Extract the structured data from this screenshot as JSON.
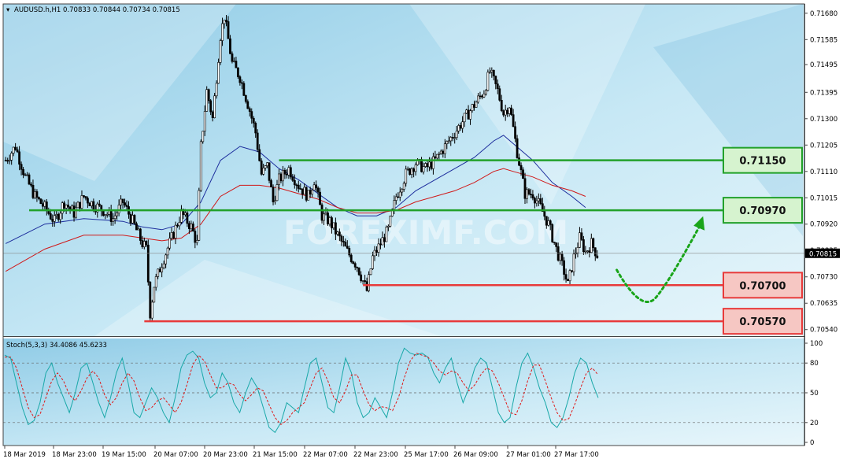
{
  "header": {
    "symbol_line": "AUDUSD.h,H1  0.70833 0.70844 0.70734 0.70815"
  },
  "stoch_header": "Stoch(5,3,3) 34.4086 45.6233",
  "watermark": "FOREXIMF.COM",
  "colors": {
    "bg_top": "#9fd3ea",
    "bg_bottom": "#d9f0f9",
    "bull": "#ffffff",
    "bear": "#000000",
    "ma_blue": "#1c2c9c",
    "ma_red": "#d01818",
    "support": "#e83a3a",
    "resistance": "#22a12a",
    "stoch_main": "#19a8a8",
    "stoch_signal": "#e01818",
    "arrow": "#1aa51a"
  },
  "chart_data": [
    {
      "type": "candlestick",
      "title": "AUDUSD.h,H1",
      "ohlc_readout": {
        "open": 0.70833,
        "high": 0.70844,
        "low": 0.70734,
        "close": 0.70815
      },
      "last_price_label": "0.70815",
      "ylim": [
        0.70525,
        0.71705
      ],
      "y_ticks": [
        "0.71680",
        "0.71585",
        "0.71495",
        "0.71395",
        "0.71300",
        "0.71205",
        "0.71110",
        "0.71015",
        "0.70920",
        "0.70825",
        "0.70730",
        "0.70635",
        "0.70540"
      ],
      "x_ticks": [
        "18 Mar 2019",
        "18 Mar 23:00",
        "19 Mar 15:00",
        "20 Mar 07:00",
        "20 Mar 23:00",
        "21 Mar 15:00",
        "22 Mar 07:00",
        "22 Mar 23:00",
        "25 Mar 17:00",
        "26 Mar 09:00",
        "27 Mar 01:00",
        "27 Mar 17:00"
      ],
      "path_points": [
        [
          0,
          0.7115
        ],
        [
          5,
          0.712
        ],
        [
          10,
          0.7109
        ],
        [
          15,
          0.7102
        ],
        [
          20,
          0.7098
        ],
        [
          25,
          0.7093
        ],
        [
          30,
          0.71
        ],
        [
          35,
          0.7096
        ],
        [
          40,
          0.7102
        ],
        [
          45,
          0.7099
        ],
        [
          50,
          0.7097
        ],
        [
          55,
          0.7094
        ],
        [
          60,
          0.71
        ],
        [
          65,
          0.7093
        ],
        [
          70,
          0.7085
        ],
        [
          72,
          0.7083
        ],
        [
          74,
          0.706
        ],
        [
          76,
          0.707
        ],
        [
          80,
          0.7078
        ],
        [
          85,
          0.7087
        ],
        [
          90,
          0.7096
        ],
        [
          95,
          0.7091
        ],
        [
          98,
          0.7085
        ],
        [
          100,
          0.712
        ],
        [
          103,
          0.714
        ],
        [
          106,
          0.713
        ],
        [
          110,
          0.716
        ],
        [
          112,
          0.7167
        ],
        [
          116,
          0.715
        ],
        [
          120,
          0.7145
        ],
        [
          125,
          0.7133
        ],
        [
          128,
          0.7125
        ],
        [
          131,
          0.711
        ],
        [
          134,
          0.7113
        ],
        [
          137,
          0.71
        ],
        [
          140,
          0.7108
        ],
        [
          145,
          0.7112
        ],
        [
          150,
          0.7106
        ],
        [
          155,
          0.7102
        ],
        [
          158,
          0.7108
        ],
        [
          162,
          0.7095
        ],
        [
          166,
          0.7093
        ],
        [
          170,
          0.7088
        ],
        [
          175,
          0.7082
        ],
        [
          180,
          0.7077
        ],
        [
          185,
          0.7068
        ],
        [
          188,
          0.708
        ],
        [
          192,
          0.7085
        ],
        [
          196,
          0.709
        ],
        [
          200,
          0.7102
        ],
        [
          205,
          0.711
        ],
        [
          210,
          0.7114
        ],
        [
          215,
          0.7112
        ],
        [
          220,
          0.7115
        ],
        [
          225,
          0.712
        ],
        [
          230,
          0.7125
        ],
        [
          235,
          0.713
        ],
        [
          240,
          0.7135
        ],
        [
          245,
          0.714
        ],
        [
          248,
          0.7147
        ],
        [
          252,
          0.714
        ],
        [
          255,
          0.7132
        ],
        [
          258,
          0.7135
        ],
        [
          262,
          0.7118
        ],
        [
          266,
          0.7103
        ],
        [
          270,
          0.7103
        ],
        [
          274,
          0.7098
        ],
        [
          278,
          0.7092
        ],
        [
          282,
          0.7083
        ],
        [
          286,
          0.7075
        ],
        [
          288,
          0.707
        ],
        [
          291,
          0.708
        ],
        [
          294,
          0.7087
        ],
        [
          297,
          0.7082
        ],
        [
          300,
          0.7085
        ],
        [
          303,
          0.7081
        ]
      ],
      "moving_averages": [
        {
          "color": "blue",
          "points": [
            [
              0,
              0.7085
            ],
            [
              20,
              0.7092
            ],
            [
              40,
              0.7094
            ],
            [
              60,
              0.7093
            ],
            [
              70,
              0.7091
            ],
            [
              80,
              0.709
            ],
            [
              90,
              0.7092
            ],
            [
              100,
              0.71
            ],
            [
              110,
              0.7115
            ],
            [
              120,
              0.712
            ],
            [
              130,
              0.7118
            ],
            [
              140,
              0.7112
            ],
            [
              150,
              0.7108
            ],
            [
              160,
              0.7103
            ],
            [
              170,
              0.7098
            ],
            [
              180,
              0.7095
            ],
            [
              190,
              0.7095
            ],
            [
              200,
              0.7098
            ],
            [
              210,
              0.7104
            ],
            [
              220,
              0.7108
            ],
            [
              230,
              0.7112
            ],
            [
              240,
              0.7116
            ],
            [
              250,
              0.7122
            ],
            [
              255,
              0.7124
            ],
            [
              260,
              0.7121
            ],
            [
              270,
              0.7115
            ],
            [
              280,
              0.7107
            ],
            [
              290,
              0.7102
            ],
            [
              297,
              0.7098
            ]
          ]
        },
        {
          "color": "red",
          "points": [
            [
              0,
              0.7075
            ],
            [
              20,
              0.7083
            ],
            [
              40,
              0.7088
            ],
            [
              60,
              0.7088
            ],
            [
              70,
              0.7087
            ],
            [
              80,
              0.7086
            ],
            [
              90,
              0.7087
            ],
            [
              100,
              0.7092
            ],
            [
              110,
              0.7102
            ],
            [
              120,
              0.7106
            ],
            [
              130,
              0.7106
            ],
            [
              140,
              0.7105
            ],
            [
              150,
              0.7103
            ],
            [
              160,
              0.7101
            ],
            [
              170,
              0.7098
            ],
            [
              180,
              0.7096
            ],
            [
              190,
              0.7096
            ],
            [
              200,
              0.7097
            ],
            [
              210,
              0.71
            ],
            [
              220,
              0.7102
            ],
            [
              230,
              0.7104
            ],
            [
              240,
              0.7107
            ],
            [
              250,
              0.7111
            ],
            [
              255,
              0.7112
            ],
            [
              260,
              0.7111
            ],
            [
              270,
              0.7109
            ],
            [
              280,
              0.7106
            ],
            [
              290,
              0.7104
            ],
            [
              297,
              0.7102
            ]
          ]
        }
      ],
      "levels": [
        {
          "label": "0.71150",
          "value": 0.7115,
          "kind": "resistance",
          "x_start": 140
        },
        {
          "label": "0.70970",
          "value": 0.7097,
          "kind": "resistance",
          "x_start": 12
        },
        {
          "label": "0.70700",
          "value": 0.707,
          "kind": "support",
          "x_start": 183
        },
        {
          "label": "0.70570",
          "value": 0.7057,
          "kind": "support",
          "x_start": 71
        }
      ],
      "projection": {
        "from": [
          313,
          0.70755
        ],
        "low": [
          326,
          0.7068
        ],
        "to": [
          356,
          0.7092
        ]
      }
    },
    {
      "type": "line",
      "title": "Stoch(5,3,3)",
      "main_value": 34.4086,
      "signal_value": 45.6233,
      "ylim": [
        0,
        100
      ],
      "y_ticks": [
        "100",
        "80",
        "50",
        "20",
        "0"
      ],
      "levels": [
        80,
        50,
        20
      ],
      "series": [
        {
          "line": "main",
          "values": [
            88,
            85,
            60,
            35,
            18,
            22,
            40,
            70,
            80,
            60,
            45,
            30,
            50,
            75,
            80,
            60,
            40,
            25,
            45,
            70,
            85,
            60,
            30,
            25,
            40,
            55,
            45,
            30,
            20,
            45,
            75,
            88,
            92,
            85,
            60,
            45,
            50,
            70,
            60,
            40,
            30,
            50,
            65,
            55,
            35,
            15,
            10,
            20,
            40,
            35,
            30,
            55,
            80,
            85,
            60,
            35,
            30,
            55,
            85,
            70,
            40,
            25,
            30,
            45,
            35,
            25,
            50,
            80,
            95,
            90,
            88,
            90,
            86,
            70,
            60,
            75,
            85,
            60,
            40,
            55,
            75,
            85,
            80,
            55,
            30,
            20,
            25,
            55,
            80,
            90,
            75,
            55,
            40,
            20,
            15,
            25,
            45,
            70,
            85,
            80,
            60,
            45
          ]
        },
        {
          "line": "signal",
          "values": [
            86,
            86,
            75,
            55,
            35,
            25,
            28,
            45,
            62,
            70,
            62,
            48,
            42,
            52,
            65,
            72,
            65,
            48,
            38,
            45,
            60,
            70,
            62,
            45,
            32,
            35,
            42,
            45,
            38,
            30,
            40,
            58,
            78,
            88,
            82,
            68,
            55,
            55,
            60,
            58,
            48,
            42,
            48,
            55,
            52,
            38,
            25,
            18,
            22,
            30,
            35,
            40,
            55,
            70,
            75,
            62,
            45,
            40,
            52,
            68,
            68,
            52,
            38,
            32,
            36,
            35,
            32,
            45,
            65,
            82,
            90,
            88,
            86,
            80,
            72,
            68,
            72,
            70,
            60,
            52,
            58,
            68,
            75,
            72,
            60,
            45,
            30,
            28,
            42,
            62,
            78,
            78,
            62,
            45,
            30,
            22,
            24,
            38,
            55,
            70,
            75,
            68
          ]
        }
      ]
    }
  ]
}
